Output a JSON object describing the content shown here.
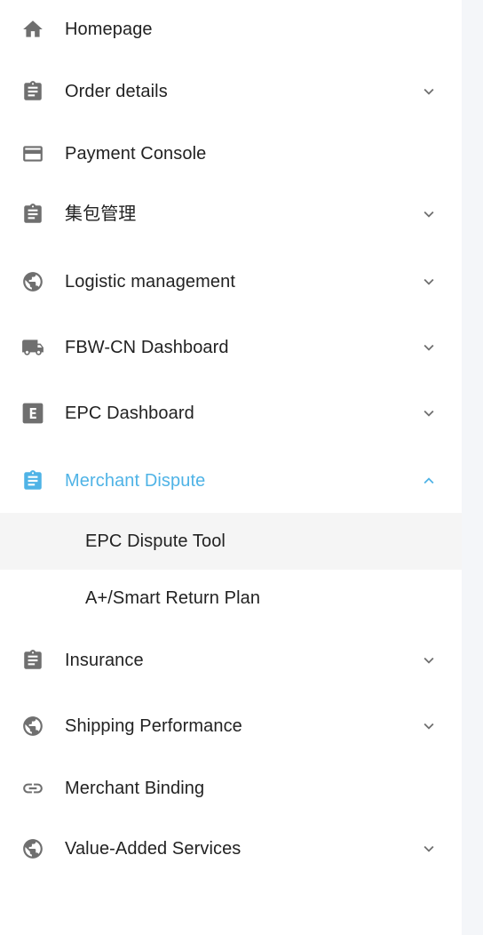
{
  "sidebar": {
    "items": [
      {
        "label": "Homepage",
        "icon": "home-icon",
        "expandable": false
      },
      {
        "label": "Order details",
        "icon": "clipboard-icon",
        "expandable": true
      },
      {
        "label": "Payment Console",
        "icon": "credit-card-icon",
        "expandable": false
      },
      {
        "label": "集包管理",
        "icon": "clipboard-icon",
        "expandable": true
      },
      {
        "label": "Logistic management",
        "icon": "globe-icon",
        "expandable": true
      },
      {
        "label": "FBW-CN Dashboard",
        "icon": "truck-icon",
        "expandable": true
      },
      {
        "label": "EPC Dashboard",
        "icon": "letter-e-icon",
        "expandable": true
      },
      {
        "label": "Merchant Dispute",
        "icon": "clipboard-icon",
        "expandable": true,
        "expanded": true,
        "active": true,
        "children": [
          {
            "label": "EPC Dispute Tool",
            "selected": true
          },
          {
            "label": "A+/Smart Return Plan",
            "selected": false
          }
        ]
      },
      {
        "label": "Insurance",
        "icon": "clipboard-icon",
        "expandable": true
      },
      {
        "label": "Shipping Performance",
        "icon": "globe-icon",
        "expandable": true
      },
      {
        "label": "Merchant Binding",
        "icon": "link-icon",
        "expandable": false
      },
      {
        "label": "Value-Added Services",
        "icon": "globe-icon",
        "expandable": true
      }
    ]
  },
  "colors": {
    "active": "#4fb3e6",
    "icon": "#6f6f6f",
    "text": "#222222",
    "selected_bg": "#f5f5f5",
    "background": "#f4f6f9"
  }
}
